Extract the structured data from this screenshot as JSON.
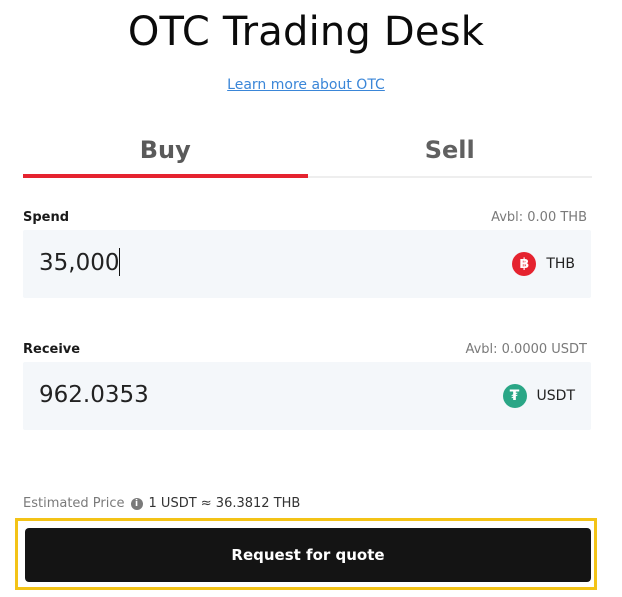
{
  "header": {
    "title": "OTC Trading Desk",
    "learn_more": "Learn more about OTC"
  },
  "tabs": [
    {
      "label": "Buy",
      "active": true
    },
    {
      "label": "Sell",
      "active": false
    }
  ],
  "spend": {
    "label": "Spend",
    "available": "Avbl: 0.00 THB",
    "value": "35,000",
    "currency": "THB",
    "currency_icon": "baht-icon"
  },
  "receive": {
    "label": "Receive",
    "available": "Avbl: 0.0000 USDT",
    "value": "962.0353",
    "currency": "USDT",
    "currency_icon": "tether-icon"
  },
  "estimate": {
    "label": "Estimated Price",
    "value": "1 USDT ≈ 36.3812 THB"
  },
  "cta": {
    "label": "Request for quote"
  },
  "colors": {
    "accent_red": "#e5232f",
    "tether_green": "#2aa686",
    "highlight_yellow": "#f3c317",
    "button_dark": "#141414",
    "link_blue": "#3a86d8"
  }
}
